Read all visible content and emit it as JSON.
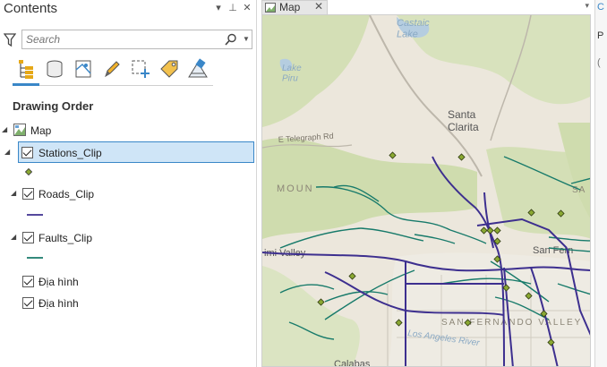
{
  "contents": {
    "title": "Contents",
    "controls": {
      "options": "▾",
      "pin": "⊥",
      "close": "✕"
    },
    "search": {
      "placeholder": "Search"
    },
    "toolbar": [
      {
        "name": "list-by-drawing-order"
      },
      {
        "name": "list-by-data-source"
      },
      {
        "name": "list-by-selection"
      },
      {
        "name": "list-by-editing"
      },
      {
        "name": "list-by-snapping"
      },
      {
        "name": "list-by-labeling"
      },
      {
        "name": "list-by-perspective-imagery"
      }
    ],
    "section_title": "Drawing Order",
    "map_label": "Map",
    "layers": [
      {
        "label": "Stations_Clip",
        "checked": true,
        "selected": true,
        "symbol": "point"
      },
      {
        "label": "Roads_Clip",
        "checked": true,
        "selected": false,
        "symbol": "line-purple"
      },
      {
        "label": "Faults_Clip",
        "checked": true,
        "selected": false,
        "symbol": "line-teal"
      },
      {
        "label": "Địa hình",
        "checked": true
      },
      {
        "label": "Địa hình",
        "checked": true
      }
    ]
  },
  "map": {
    "tab_label": "Map",
    "tab_close": "✕",
    "dropdown": "▾",
    "labels": {
      "castaic_lake": "Castaic\nLake",
      "lake_piru": "Lake\nPiru",
      "santa_clarita": "Santa\nClarita",
      "telegraph": "E Telegraph Rd",
      "mountains": "MOUN",
      "simi_valley": "imi Valley",
      "san_fernando": "San Fern",
      "san_fernando_valley": "SAN FERNANDO VALLEY",
      "los_angeles_river": "Los Angeles River",
      "calabasas": "Calabas",
      "sa_right": "SA"
    },
    "colors": {
      "terrain": "#ece7dc",
      "vegetation": "#cfdcae",
      "roads": "#3d2f8f",
      "faults": "#177a6a",
      "stations": "#8aa832",
      "water": "#b5cde0"
    }
  },
  "right_strip": {
    "items": [
      "C",
      "P",
      "("
    ]
  }
}
